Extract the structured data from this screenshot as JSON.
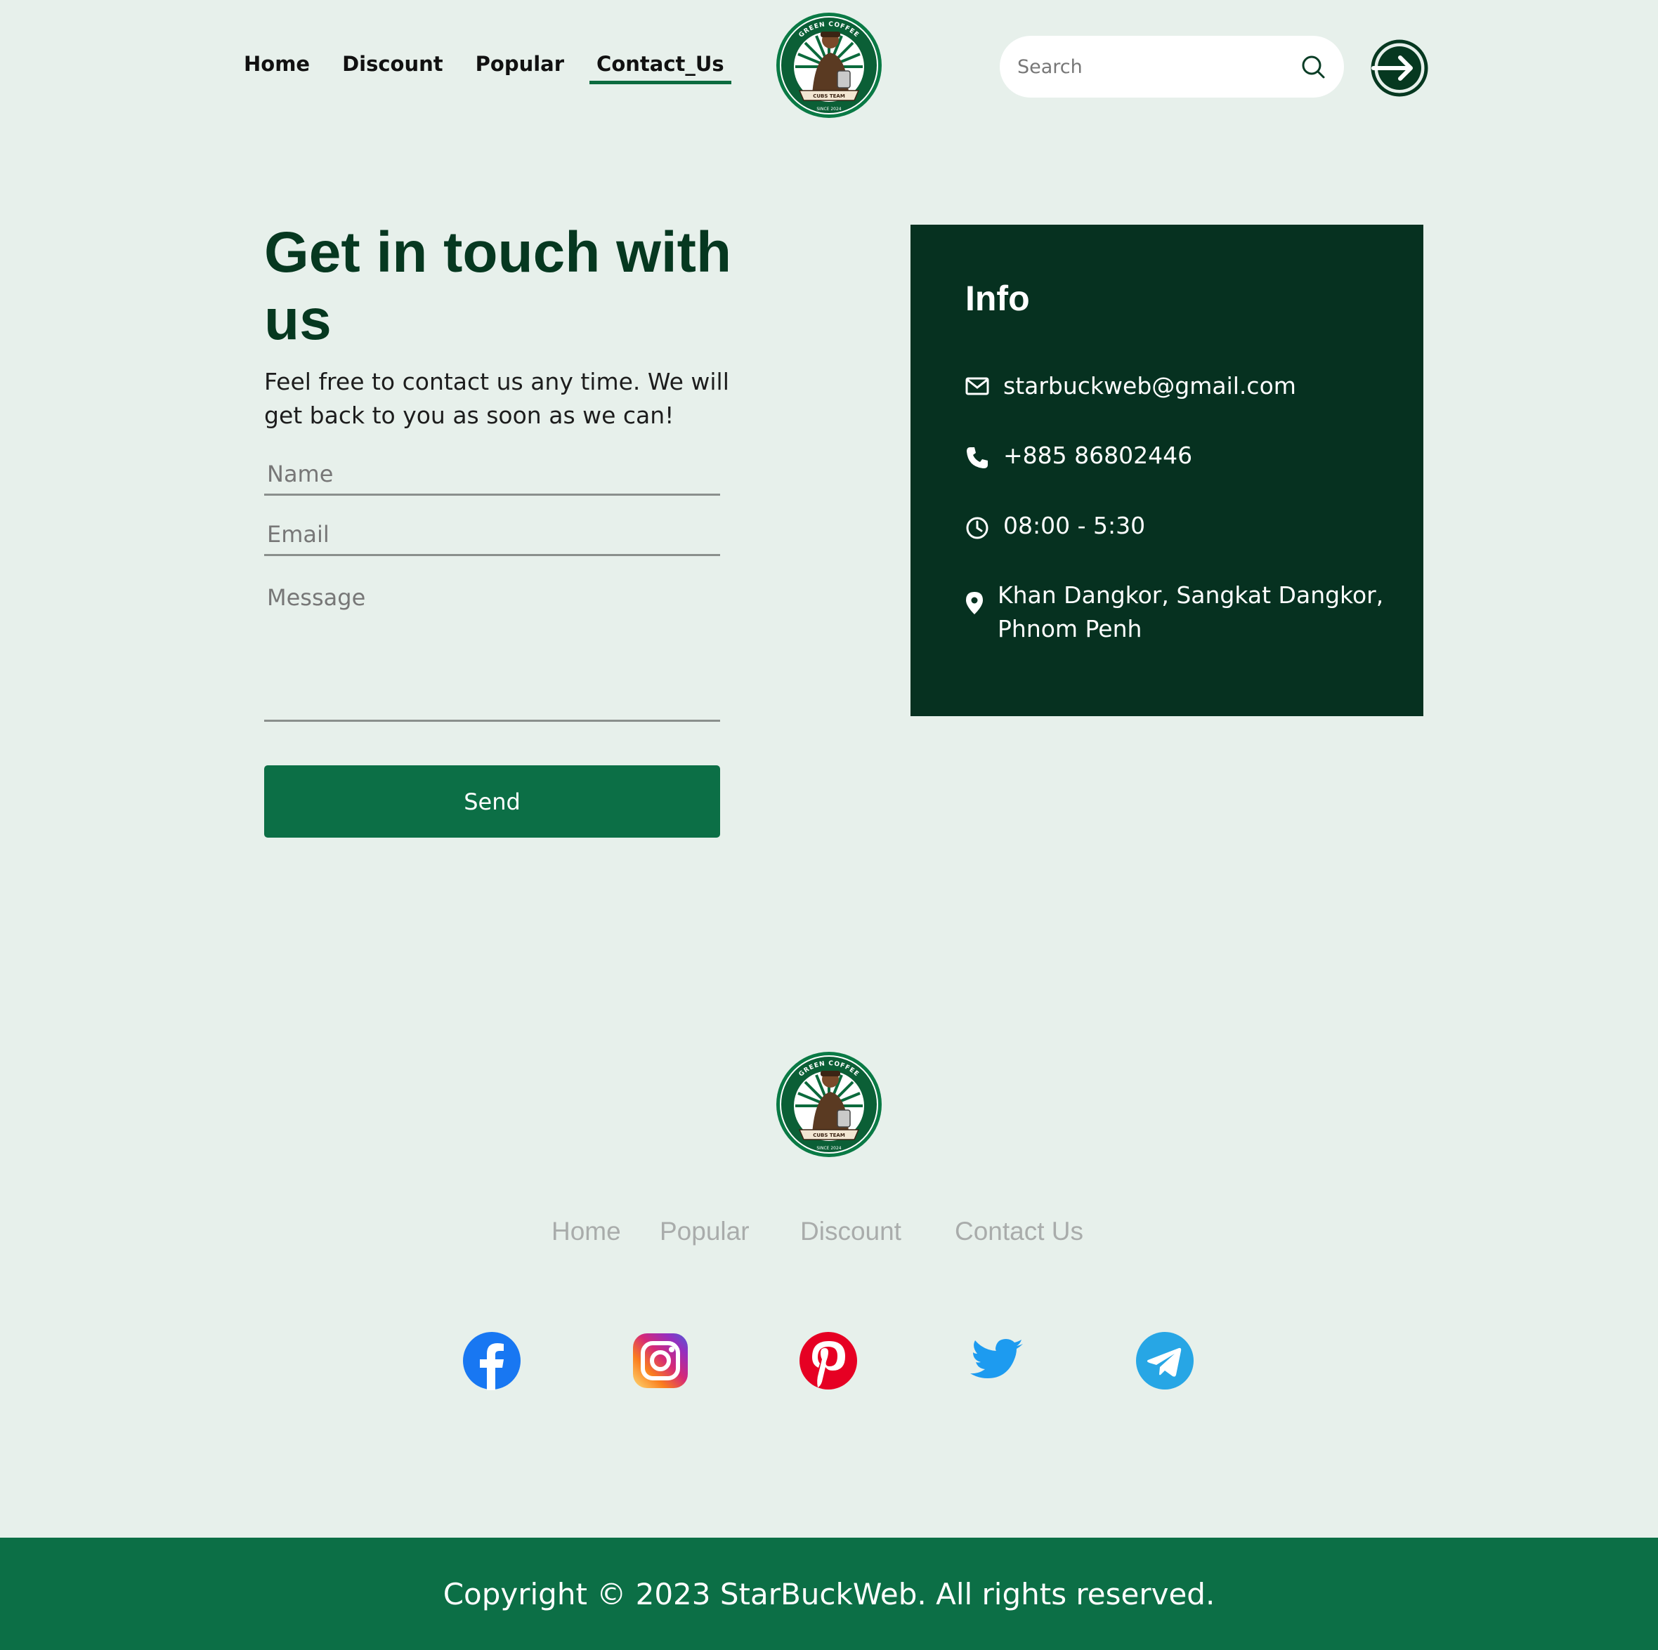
{
  "header": {
    "nav": [
      {
        "label": "Home"
      },
      {
        "label": "Discount"
      },
      {
        "label": "Popular"
      },
      {
        "label": "Contact_Us"
      }
    ],
    "search_placeholder": "Search",
    "logo_text_top": "GREEN COFFEE",
    "logo_text_banner": "CUBS TEAM",
    "logo_text_since": "SINCE 2024"
  },
  "contact": {
    "title": "Get in touch with us",
    "intro": "Feel free to contact us any time. We will get back to you as soon as we can!",
    "name_placeholder": "Name",
    "email_placeholder": "Email",
    "message_placeholder": "Message",
    "send_label": "Send"
  },
  "info": {
    "heading": "Info",
    "email": "starbuckweb@gmail.com",
    "phone": "+885 86802446",
    "hours": "08:00 - 5:30",
    "address": "Khan Dangkor, Sangkat Dangkor, Phnom Penh"
  },
  "footer": {
    "nav": [
      {
        "label": "Home"
      },
      {
        "label": "Popular"
      },
      {
        "label": "Discount"
      },
      {
        "label": "Contact Us"
      }
    ],
    "social": [
      "facebook-icon",
      "instagram-icon",
      "pinterest-icon",
      "twitter-icon",
      "telegram-icon"
    ],
    "copyright": "Copyright © 2023 StarBuckWeb. All rights reserved."
  },
  "colors": {
    "background": "#e7f0eb",
    "dark_green": "#063120",
    "brand_green": "#0c6f46"
  }
}
